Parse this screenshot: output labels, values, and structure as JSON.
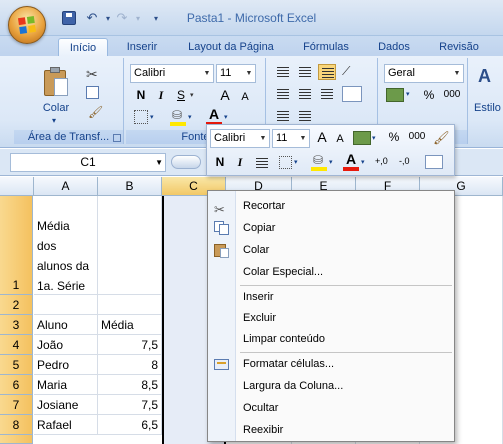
{
  "window": {
    "title": "Pasta1 - Microsoft Excel"
  },
  "tabs": [
    "Início",
    "Inserir",
    "Layout da Página",
    "Fórmulas",
    "Dados",
    "Revisão"
  ],
  "ribbon": {
    "clipboard": {
      "paste_label": "Colar",
      "group_label": "Área de Transf..."
    },
    "font": {
      "name": "Calibri",
      "size": "11",
      "group_label": "Fonte",
      "bold": "N",
      "italic": "I",
      "underline": "S",
      "grow": "A",
      "shrink": "A",
      "color_letter": "A"
    },
    "number": {
      "format": "Geral",
      "percent": "%",
      "thousands": "000"
    },
    "styles": {
      "label": "Estilo",
      "icon_letter": "A"
    }
  },
  "formula_bar": {
    "name_box": "C1"
  },
  "grid": {
    "columns": [
      "A",
      "B",
      "C",
      "D",
      "E",
      "F",
      "G"
    ],
    "rows": [
      {
        "num": "1",
        "a": [
          "Média",
          "dos",
          "alunos da",
          "1a. Série"
        ],
        "b": ""
      },
      {
        "num": "2",
        "a": "",
        "b": ""
      },
      {
        "num": "3",
        "a": "Aluno",
        "b": "Média"
      },
      {
        "num": "4",
        "a": "João",
        "b": "7,5"
      },
      {
        "num": "5",
        "a": "Pedro",
        "b": "8"
      },
      {
        "num": "6",
        "a": "Maria",
        "b": "8,5"
      },
      {
        "num": "7",
        "a": "Josiane",
        "b": "7,5"
      },
      {
        "num": "8",
        "a": "Rafael",
        "b": "6,5"
      }
    ]
  },
  "mini_toolbar": {
    "font": "Calibri",
    "size": "11",
    "grow": "A",
    "shrink": "A",
    "percent": "%",
    "thousands": "000",
    "bold": "N",
    "italic": "I",
    "color_letter": "A",
    "inc_decimal": "+,0",
    "dec_decimal": "-,0"
  },
  "context_menu": {
    "items": [
      {
        "label": "Recortar",
        "icon": "scissors-icon"
      },
      {
        "label": "Copiar",
        "icon": "copy-icon"
      },
      {
        "label": "Colar",
        "icon": "paste-icon"
      },
      {
        "label": "Colar Especial...",
        "icon": ""
      },
      {
        "label": "Inserir",
        "icon": ""
      },
      {
        "label": "Excluir",
        "icon": ""
      },
      {
        "label": "Limpar conteúdo",
        "icon": ""
      },
      {
        "label": "Formatar células...",
        "icon": "format-cells-icon"
      },
      {
        "label": "Largura da Coluna...",
        "icon": ""
      },
      {
        "label": "Ocultar",
        "icon": ""
      },
      {
        "label": "Reexibir",
        "icon": ""
      }
    ]
  },
  "colors": {
    "accent": "#15428b",
    "highlight": "#f9d67a",
    "font_red": "#e8190c"
  }
}
